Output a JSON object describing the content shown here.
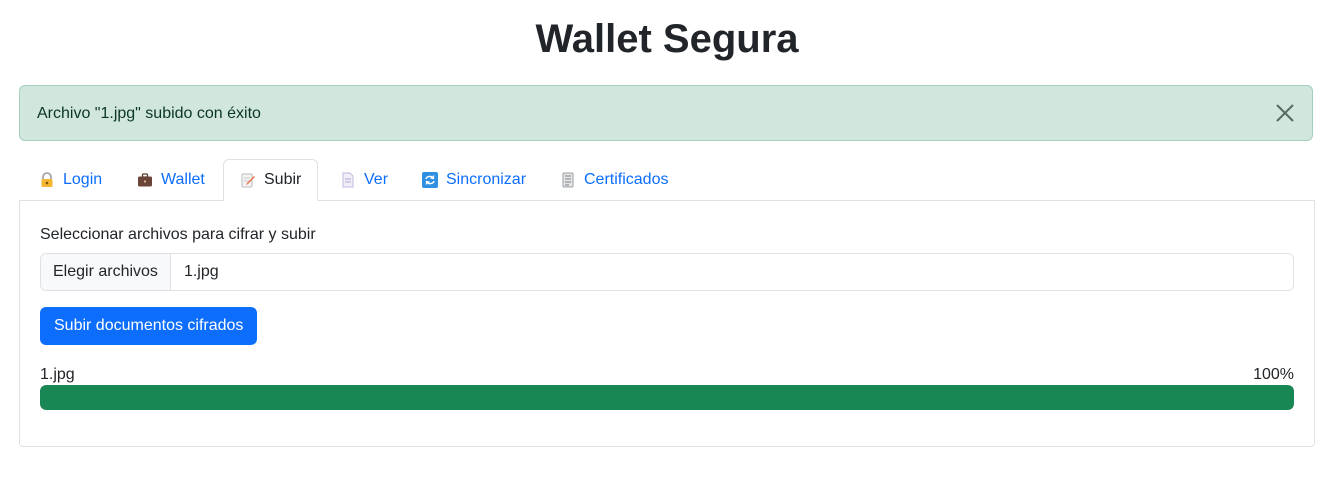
{
  "title": "Wallet Segura",
  "alert": {
    "message": "Archivo \"1.jpg\" subido con éxito",
    "close_icon": "close-icon",
    "color": "#d1e7dd"
  },
  "tabs": [
    {
      "label": "Login",
      "icon": "lock-icon",
      "active": false
    },
    {
      "label": "Wallet",
      "icon": "briefcase-icon",
      "active": false
    },
    {
      "label": "Subir",
      "icon": "memo-icon",
      "active": true
    },
    {
      "label": "Ver",
      "icon": "document-icon",
      "active": false
    },
    {
      "label": "Sincronizar",
      "icon": "sync-icon",
      "active": false
    },
    {
      "label": "Certificados",
      "icon": "certificate-icon",
      "active": false
    }
  ],
  "upload": {
    "label": "Seleccionar archivos para cifrar y subir",
    "choose_button": "Elegir archivos",
    "selected_file": "1.jpg",
    "submit_label": "Subir documentos cifrados"
  },
  "progress": {
    "file": "1.jpg",
    "percent_label": "100%",
    "value": 1.0,
    "color": "#198754"
  },
  "colors": {
    "accent": "#0d6efd",
    "success": "#198754"
  }
}
